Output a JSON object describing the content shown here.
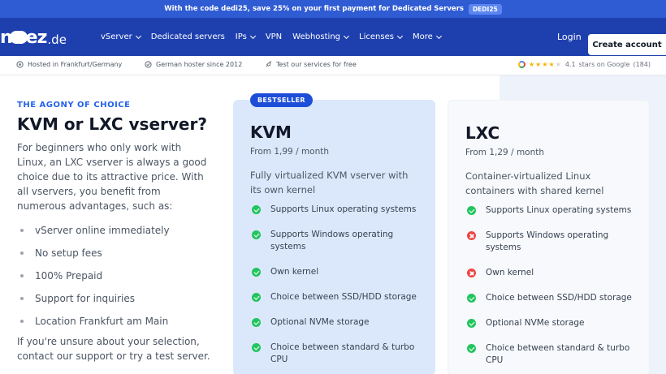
{
  "promo": {
    "text": "With the code dedi25, save 25% on your first payment for Dedicated Servers",
    "badge": "DEDI25"
  },
  "brand": {
    "logo_left": "n",
    "logo_right": "ez",
    "tld": ".de"
  },
  "nav": {
    "items": [
      {
        "label": "vServer",
        "dropdown": true
      },
      {
        "label": "Dedicated servers",
        "dropdown": false
      },
      {
        "label": "IPs",
        "dropdown": true
      },
      {
        "label": "VPN",
        "dropdown": false
      },
      {
        "label": "Webhosting",
        "dropdown": true
      },
      {
        "label": "Licenses",
        "dropdown": true
      },
      {
        "label": "More",
        "dropdown": true
      }
    ],
    "login": "Login",
    "create_account": "Create account"
  },
  "trust": {
    "hosted": "Hosted in Frankfurt/Germany",
    "hoster": "German hoster since 2012",
    "test": "Test our services for free",
    "rating_value": "4.1",
    "rating_text": "stars on Google",
    "rating_count": "(184)",
    "stars_filled": 4
  },
  "left": {
    "kicker": "THE AGONY OF CHOICE",
    "title": "KVM or LXC vserver?",
    "intro": "For beginners who only work with Linux, an LXC vserver is always a good choice due to its attractive price. With all vservers, you benefit from numerous advantages, such as:",
    "bullets": [
      "vServer online immediately",
      "No setup fees",
      "100% Prepaid",
      "Support for inquiries",
      "Location Frankfurt am Main"
    ],
    "outro": "If you're unsure about your selection, contact our support or try a test server."
  },
  "cards": {
    "kvm": {
      "tag": "BESTSELLER",
      "name": "KVM",
      "price": "From 1,99 / month",
      "desc": "Fully virtualized KVM vserver with its own kernel",
      "features": [
        {
          "text": "Supports Linux operating systems",
          "ok": true
        },
        {
          "text": "Supports Windows operating systems",
          "ok": true
        },
        {
          "text": "Own kernel",
          "ok": true
        },
        {
          "text": "Choice between SSD/HDD storage",
          "ok": true
        },
        {
          "text": "Optional NVMe storage",
          "ok": true
        },
        {
          "text": "Choice between standard & turbo CPU",
          "ok": true
        }
      ]
    },
    "lxc": {
      "name": "LXC",
      "price": "From 1,29 / month",
      "desc": "Container-virtualized Linux containers with shared kernel",
      "features": [
        {
          "text": "Supports Linux operating systems",
          "ok": true
        },
        {
          "text": "Supports Windows operating systems",
          "ok": false
        },
        {
          "text": "Own kernel",
          "ok": false
        },
        {
          "text": "Choice between SSD/HDD storage",
          "ok": true
        },
        {
          "text": "Optional NVMe storage",
          "ok": true
        },
        {
          "text": "Choice between standard & turbo CPU",
          "ok": true
        }
      ]
    }
  },
  "colors": {
    "promo_bg": "#2f5bd3",
    "nav_bg": "#1e40af",
    "accent": "#2563eb",
    "ok": "#22c55e",
    "no": "#ef4444"
  }
}
